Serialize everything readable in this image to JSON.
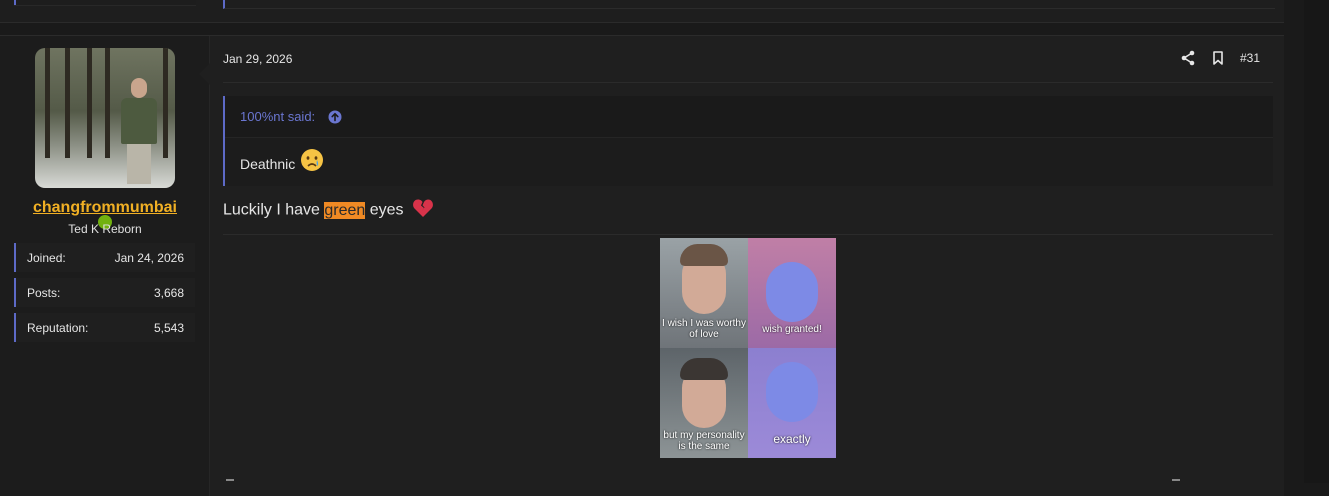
{
  "post": {
    "date": "Jan 29, 2026",
    "number": "#31",
    "user": {
      "name": "changfrommumbai",
      "title": "Ted K Reborn",
      "stats": [
        {
          "label": "Joined:",
          "value": "Jan 24, 2026"
        },
        {
          "label": "Posts:",
          "value": "3,668"
        },
        {
          "label": "Reputation:",
          "value": "5,543"
        }
      ]
    },
    "quote": {
      "author": "100%nt said:",
      "text": "Deathnic"
    },
    "body": {
      "before": "Luckily I have ",
      "highlight": "green",
      "after": " eyes"
    },
    "meme": {
      "captions": [
        "I wish I was worthy of love",
        "wish granted!",
        "but my personality is the same",
        "exactly"
      ]
    }
  },
  "colors": {
    "accent": "#5d6ac7",
    "username": "#f1b024",
    "online": "#71b10f",
    "highlight": "#f08a24"
  },
  "icons": [
    "share-icon",
    "bookmark-icon",
    "arrow-up-circle-icon",
    "crying-face-emoji",
    "broken-heart-emoji"
  ]
}
